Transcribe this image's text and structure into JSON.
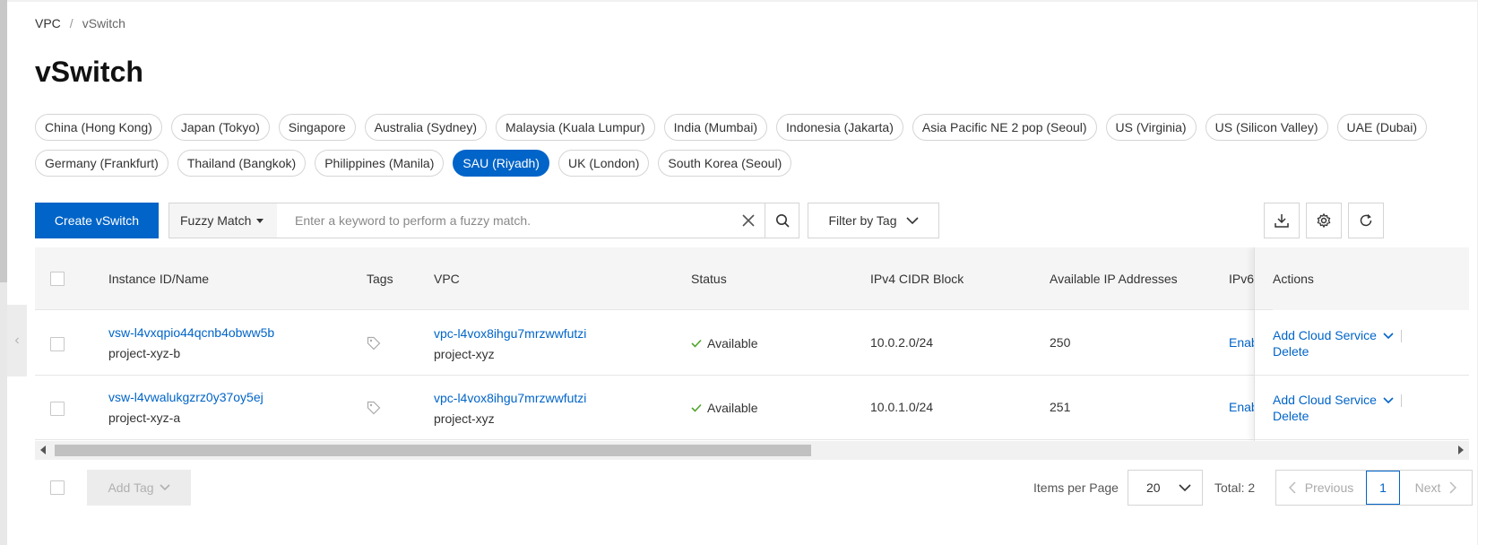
{
  "breadcrumb": {
    "root": "VPC",
    "separator": "/",
    "current": "vSwitch"
  },
  "page_title": "vSwitch",
  "regions": [
    {
      "label": "China (Hong Kong)",
      "active": false
    },
    {
      "label": "Japan (Tokyo)",
      "active": false
    },
    {
      "label": "Singapore",
      "active": false
    },
    {
      "label": "Australia (Sydney)",
      "active": false
    },
    {
      "label": "Malaysia (Kuala Lumpur)",
      "active": false
    },
    {
      "label": "India (Mumbai)",
      "active": false
    },
    {
      "label": "Indonesia (Jakarta)",
      "active": false
    },
    {
      "label": "Asia Pacific NE 2 pop (Seoul)",
      "active": false
    },
    {
      "label": "US (Virginia)",
      "active": false
    },
    {
      "label": "US (Silicon Valley)",
      "active": false
    },
    {
      "label": "UAE (Dubai)",
      "active": false
    },
    {
      "label": "Germany (Frankfurt)",
      "active": false
    },
    {
      "label": "Thailand (Bangkok)",
      "active": false
    },
    {
      "label": "Philippines (Manila)",
      "active": false
    },
    {
      "label": "SAU (Riyadh)",
      "active": true
    },
    {
      "label": "UK (London)",
      "active": false
    },
    {
      "label": "South Korea (Seoul)",
      "active": false
    }
  ],
  "toolbar": {
    "create_label": "Create vSwitch",
    "match_mode": "Fuzzy Match",
    "search_placeholder": "Enter a keyword to perform a fuzzy match.",
    "filter_tag_label": "Filter by Tag",
    "icons": [
      "download-icon",
      "settings-icon",
      "refresh-icon"
    ]
  },
  "table": {
    "columns": {
      "instance": "Instance ID/Name",
      "tags": "Tags",
      "vpc": "VPC",
      "status": "Status",
      "ipv4": "IPv4 CIDR Block",
      "available": "Available IP Addresses",
      "ipv6": "IPv6",
      "actions": "Actions"
    },
    "rows": [
      {
        "id": "vsw-l4vxqpio44qcnb4obww5b",
        "name": "project-xyz-b",
        "vpc_id": "vpc-l4vox8ihgu7mrzwwfutzi",
        "vpc_name": "project-xyz",
        "status": "Available",
        "ipv4": "10.0.2.0/24",
        "available": "250",
        "ipv6": "Enab",
        "action_add": "Add Cloud Service",
        "action_delete": "Delete"
      },
      {
        "id": "vsw-l4vwalukgzrz0y37oy5ej",
        "name": "project-xyz-a",
        "vpc_id": "vpc-l4vox8ihgu7mrzwwfutzi",
        "vpc_name": "project-xyz",
        "status": "Available",
        "ipv4": "10.0.1.0/24",
        "available": "251",
        "ipv6": "Enab",
        "action_add": "Add Cloud Service",
        "action_delete": "Delete"
      }
    ]
  },
  "footer": {
    "add_tag_label": "Add Tag",
    "items_per_page_label": "Items per Page",
    "page_size": "20",
    "total_label": "Total: 2",
    "prev_label": "Previous",
    "current_page": "1",
    "next_label": "Next"
  },
  "colors": {
    "accent": "#0064c8",
    "status_ok": "#52a52e"
  }
}
